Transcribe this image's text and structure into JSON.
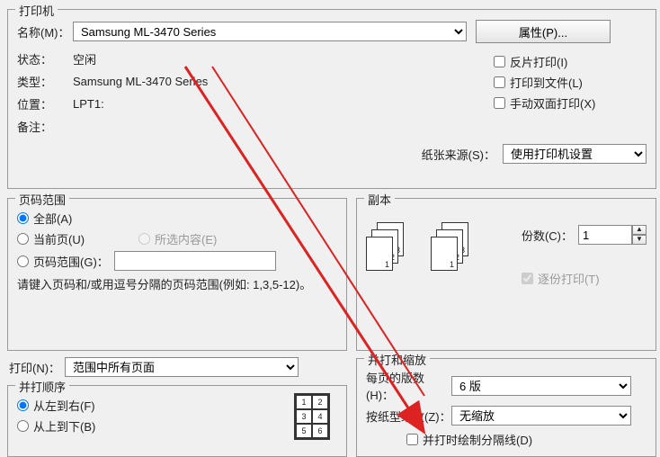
{
  "printer": {
    "group_title": "打印机",
    "name_label": "名称(M)：",
    "name_value": "Samsung ML-3470 Series",
    "properties_btn": "属性(P)...",
    "status_label": "状态：",
    "status_value": "空闲",
    "type_label": "类型：",
    "type_value": "Samsung ML-3470 Series",
    "where_label": "位置：",
    "where_value": "LPT1:",
    "comment_label": "备注：",
    "comment_value": "",
    "reverse_label": "反片打印(I)",
    "to_file_label": "打印到文件(L)",
    "manual_duplex_label": "手动双面打印(X)",
    "paper_source_label": "纸张来源(S)：",
    "paper_source_value": "使用打印机设置"
  },
  "range": {
    "group_title": "页码范围",
    "all_label": "全部(A)",
    "current_label": "当前页(U)",
    "selection_label": "所选内容(E)",
    "pages_label": "页码范围(G)：",
    "pages_value": "",
    "hint": "请键入页码和/或用逗号分隔的页码范围(例如: 1,3,5-12)。"
  },
  "copies": {
    "group_title": "副本",
    "count_label": "份数(C)：",
    "count_value": "1",
    "collate_label": "逐份打印(T)"
  },
  "print_what": {
    "label": "打印(N)：",
    "value": "范围中所有页面"
  },
  "order": {
    "group_title": "并打顺序",
    "lr_label": "从左到右(F)",
    "tb_label": "从上到下(B)"
  },
  "zoom": {
    "group_title": "并打和缩放",
    "pages_per_sheet_label": "每页的版数(H)：",
    "pages_per_sheet_value": "6 版",
    "scale_label": "按纸型缩放(Z)：",
    "scale_value": "无缩放",
    "border_label": "并打时绘制分隔线(D)"
  }
}
